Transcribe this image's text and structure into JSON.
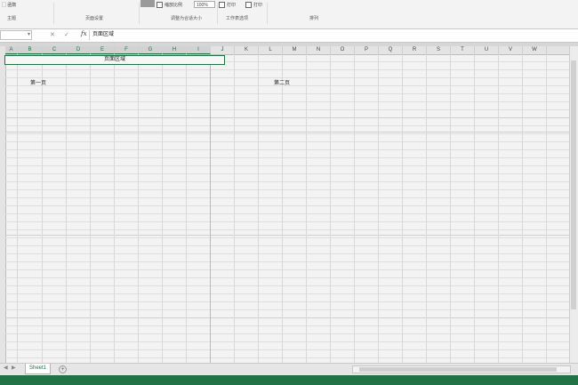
{
  "ribbon": {
    "top_items": [
      {
        "label": "▢ 函数",
        "checkbox": false
      },
      {
        "label": "缩放比例",
        "checkbox": true
      },
      {
        "label": "打印",
        "checkbox": true
      },
      {
        "label": "打印",
        "checkbox": true
      }
    ],
    "zoom_value": "100%",
    "groups": [
      "主题",
      "页面设置",
      "调整为合适大小",
      "工作表选项",
      "排列"
    ]
  },
  "formula_bar": {
    "cancel": "✕",
    "confirm": "✓",
    "fx": "fx",
    "value": "页面区域"
  },
  "columns": [
    "A",
    "B",
    "C",
    "D",
    "E",
    "F",
    "G",
    "H",
    "I",
    "J",
    "K",
    "L",
    "M",
    "N",
    "O",
    "P",
    "Q",
    "R",
    "S",
    "T",
    "U",
    "V",
    "W"
  ],
  "cells": {
    "merged_title": "页面区域",
    "page1": "第一页",
    "page2": "第二页"
  },
  "sheet_tabs": [
    "Sheet1"
  ],
  "add_sheet_icon": "plus-circle-icon",
  "colors": {
    "accent": "#217346"
  }
}
